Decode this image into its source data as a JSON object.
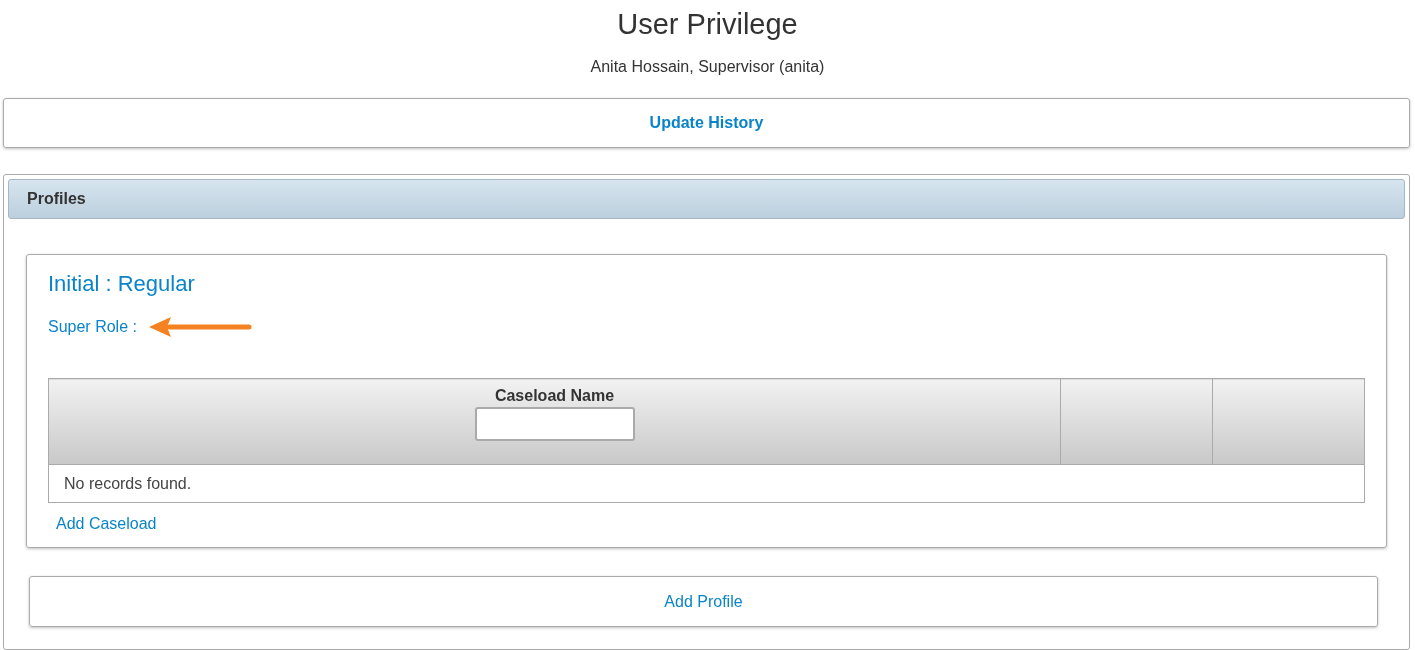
{
  "page": {
    "title": "User Privilege",
    "subtitle": "Anita Hossain, Supervisor (anita)"
  },
  "update_history": {
    "label": "Update History"
  },
  "profiles": {
    "title": "Profiles",
    "items": [
      {
        "title": "Initial : Regular",
        "super_role_label": "Super Role :",
        "table": {
          "columns": [
            {
              "kind": "filter",
              "label": "Caseload Name"
            },
            {
              "kind": "blank"
            },
            {
              "kind": "blank"
            }
          ],
          "empty_message": "No records found."
        },
        "add_caseload": "Add Caseload"
      }
    ],
    "add_profile": "Add Profile"
  }
}
